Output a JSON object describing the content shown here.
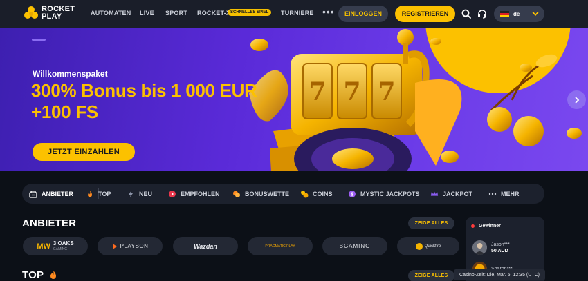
{
  "brand": {
    "line1": "ROCKET",
    "line2": "PLAY"
  },
  "nav": {
    "items": [
      "AUTOMATEN",
      "LIVE",
      "SPORT",
      "ROCKET-X",
      "TURNIERE"
    ],
    "rocketx_badge": "SCHNELLES SPIEL",
    "more": "•••"
  },
  "auth": {
    "login": "EINLOGGEN",
    "register": "REGISTRIEREN"
  },
  "language": {
    "code": "de",
    "flag": "germany-flag-icon"
  },
  "hero": {
    "kicker": "Willkommenspaket",
    "title_line1": "300% Bonus bis 1 000 EUR",
    "title_line2": "+100 FS",
    "cta": "JETZT EINZAHLEN",
    "reels": [
      "7",
      "7",
      "7"
    ]
  },
  "categories": [
    {
      "label": "ANBIETER",
      "icon": "provider-icon",
      "active": true
    },
    {
      "label": "TOP",
      "icon": "fire-icon"
    },
    {
      "label": "NEU",
      "icon": "lightning-icon"
    },
    {
      "label": "EMPFOHLEN",
      "icon": "recommended-icon"
    },
    {
      "label": "BONUSWETTE",
      "icon": "bonus-bet-icon"
    },
    {
      "label": "COINS",
      "icon": "coins-icon"
    },
    {
      "label": "MYSTIC JACKPOTS",
      "icon": "mystic-jackpot-icon"
    },
    {
      "label": "JACKPOT",
      "icon": "jackpot-crown-icon"
    },
    {
      "label": "MEHR",
      "icon": "more-icon"
    }
  ],
  "providers_section": {
    "title": "ANBIETER",
    "see_all": "ZEIGE ALLES"
  },
  "providers": [
    {
      "name": "3 OAKS",
      "mark": "MW",
      "sub": "GAMING"
    },
    {
      "name": "PLAYSON"
    },
    {
      "name": "Wazdan"
    },
    {
      "name": "PRAGMATIC PLAY"
    },
    {
      "name": "BGAMING"
    },
    {
      "name": "Quickfire"
    }
  ],
  "top_section": {
    "title": "TOP",
    "see_all": "ZEIGE ALLES"
  },
  "winners": {
    "title": "Gewinner",
    "rows": [
      {
        "name": "Jason***",
        "amount": "50 AUD"
      },
      {
        "name": "Sharon***",
        "amount": ""
      }
    ]
  },
  "casino_time": "Casino-Zeit: Die, Mar. 5, 12:35 (UTC)",
  "colors": {
    "accent": "#fcc100",
    "header": "#1a1e29",
    "background": "#0c1017",
    "hero": "#5a2ad8"
  }
}
